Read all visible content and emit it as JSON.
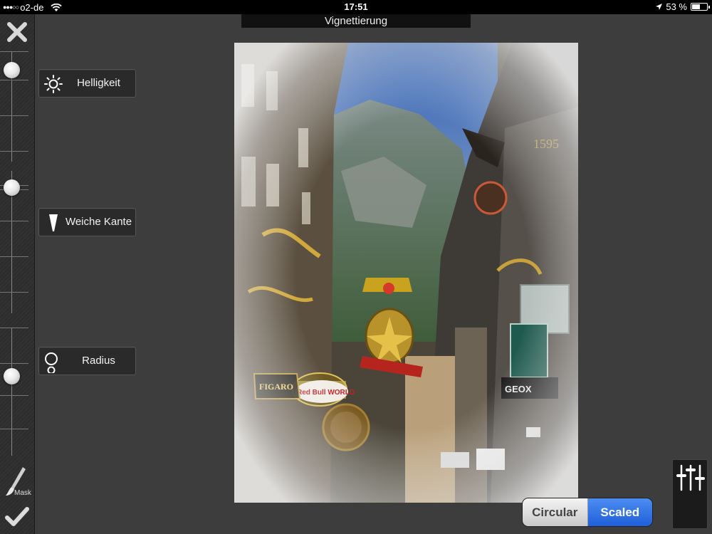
{
  "status_bar": {
    "carrier": "o2-de",
    "time": "17:51",
    "battery_text": "53 %",
    "battery_level": 0.53
  },
  "title": "Vignettierung",
  "sliders": [
    {
      "name": "Helligkeit",
      "icon": "sun-icon"
    },
    {
      "name": "Weiche Kante",
      "icon": "soft-edge-icon"
    },
    {
      "name": "Radius",
      "icon": "radius-icon"
    }
  ],
  "tools": {
    "close_icon": "close-icon",
    "mask_label": "Mask",
    "mask_icon": "brush-icon",
    "apply_icon": "checkmark-icon",
    "adjust_icon": "sliders-icon"
  },
  "mode": {
    "options": [
      "Circular",
      "Scaled"
    ],
    "selected": "Scaled"
  },
  "colors": {
    "accent": "#2f6fe6",
    "background": "#3d3d3d"
  }
}
